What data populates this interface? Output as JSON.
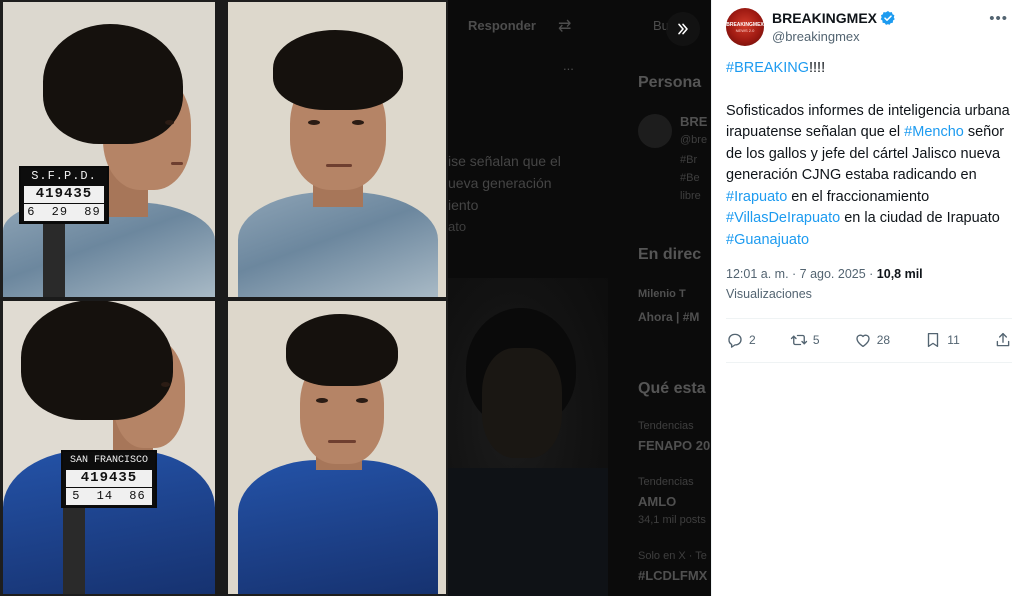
{
  "background_page": {
    "reply_label": "Responder",
    "search_partial": "Bu",
    "dots": "...",
    "section_people": "Persona",
    "person_name_partial": "BRE",
    "person_handle_partial": "@bre",
    "person_tags_partial": [
      "#Br",
      "#Be",
      "libre"
    ],
    "tweet_frag_1": "ise señalan que el",
    "tweet_frag_2": "ueva generación",
    "tweet_frag_3": "iento",
    "tweet_frag_4": "ato",
    "section_live": "En direc",
    "live_source": "Milenio T",
    "live_now": "Ahora | #M",
    "section_whats": "Qué esta",
    "trend1_label": "Tendencias",
    "trend1_name": "FENAPO 20",
    "trend2_label": "Tendencias",
    "trend2_name": "AMLO",
    "trend2_count": "34,1 mil posts",
    "trend3_label": "Solo en X · Te",
    "trend3_name": "#LCDLFMX"
  },
  "mugshot": {
    "placard_top": {
      "line1": "S.F.P.D.",
      "number": "419435",
      "date": "6 29 89"
    },
    "placard_bottom": {
      "line1": "SAN FRANCISCO",
      "number": "419435",
      "date": "5 14 86"
    }
  },
  "tweet": {
    "author_name": "BREAKINGMEX",
    "author_handle": "@breakingmex",
    "avatar_text_1": "BREAKINGMEX",
    "avatar_text_2": "NEWS 2.0",
    "verified": true,
    "body": {
      "p1_tag": "#BREAKING",
      "p1_rest": "!!!!",
      "p2_a": "Sofisticados informes de inteligencia urbana irapuatense señalan que el ",
      "tag_mencho": "#Mencho",
      "p2_b": " señor de los gallos y jefe del cártel Jalisco nueva generación CJNG estaba radicando en ",
      "tag_irapuato": "#Irapuato",
      "p2_c": " en el fraccionamiento ",
      "tag_villas": "#VillasDeIrapuato",
      "p2_d": " en la ciudad de Irapuato ",
      "tag_guanajuato": "#Guanajuato"
    },
    "timestamp": "12:01 a. m. · 7 ago. 2025 · ",
    "views_count": "10,8 mil",
    "views_label": "Visualizaciones",
    "replies": "2",
    "reposts": "5",
    "likes": "28",
    "bookmarks": "11"
  },
  "colors": {
    "link": "#1d9bf0",
    "secondary_text": "#536471",
    "verified_badge": "#1d9bf0"
  }
}
